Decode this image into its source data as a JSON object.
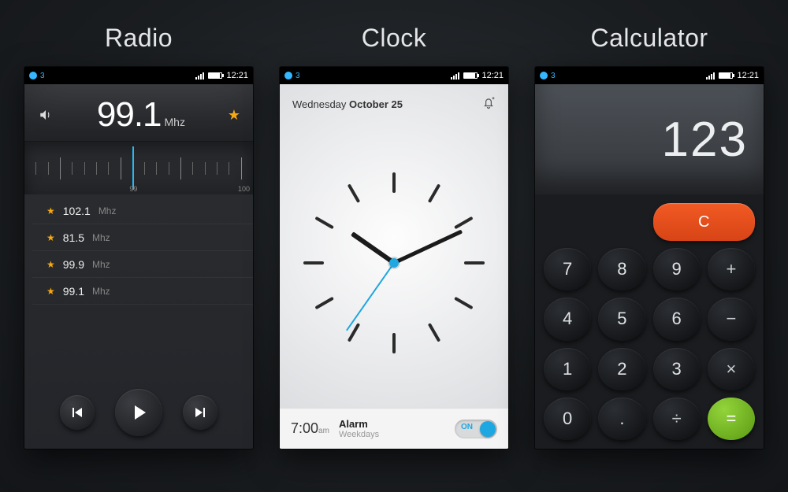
{
  "statusbar": {
    "carrier": "3",
    "time": "12:21"
  },
  "titles": {
    "radio": "Radio",
    "clock": "Clock",
    "calculator": "Calculator"
  },
  "radio": {
    "current_freq": "99.1",
    "unit": "Mhz",
    "dial_labels": {
      "mid": "99",
      "right": "100"
    },
    "favorites": [
      {
        "freq": "102.1",
        "unit": "Mhz"
      },
      {
        "freq": "81.5",
        "unit": "Mhz"
      },
      {
        "freq": "99.9",
        "unit": "Mhz"
      },
      {
        "freq": "99.1",
        "unit": "Mhz"
      }
    ]
  },
  "clock": {
    "weekday": "Wednesday",
    "date": "October 25",
    "alarm": {
      "time": "7:00",
      "ampm": "am",
      "label": "Alarm",
      "repeat": "Weekdays",
      "toggle": "ON"
    }
  },
  "calculator": {
    "display": "123",
    "clear": "C",
    "keys": [
      [
        "7",
        "8",
        "9",
        "+"
      ],
      [
        "4",
        "5",
        "6",
        "−"
      ],
      [
        "1",
        "2",
        "3",
        "×"
      ],
      [
        "0",
        ".",
        "÷",
        "="
      ]
    ]
  }
}
